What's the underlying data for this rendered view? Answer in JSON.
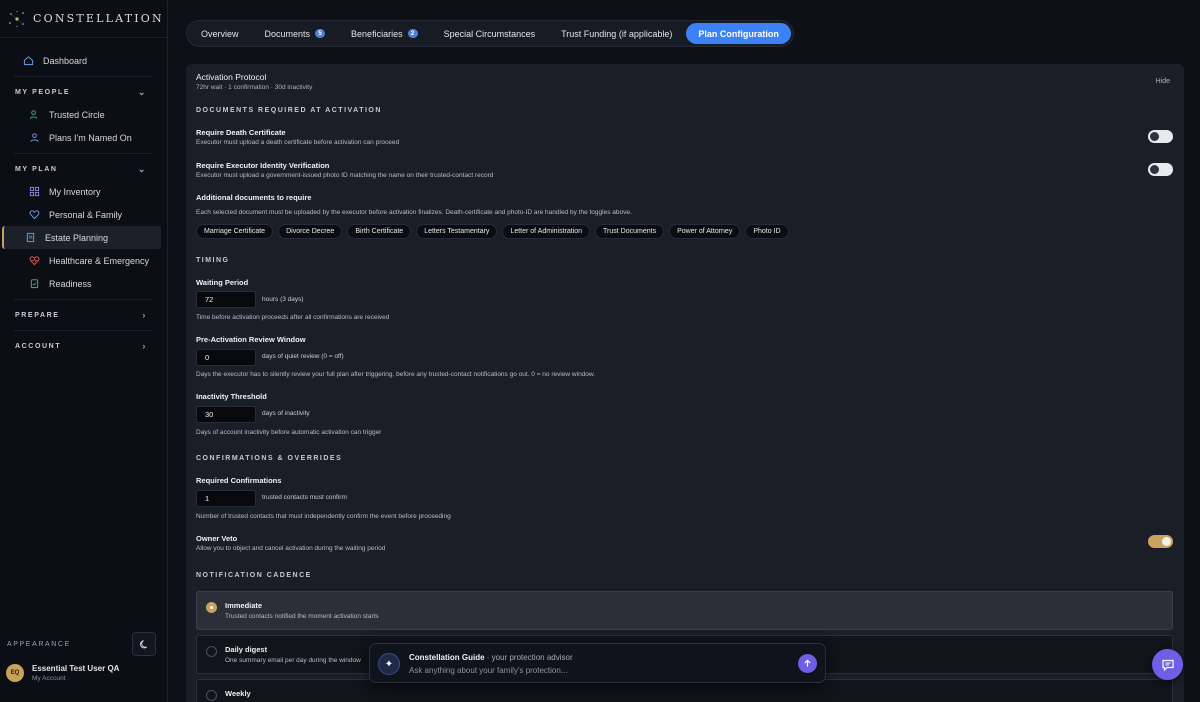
{
  "brand": {
    "name": "CONSTELLATION"
  },
  "nav": {
    "dashboard": "Dashboard",
    "my_people": {
      "label": "MY PEOPLE",
      "items": [
        "Trusted Circle",
        "Plans I'm Named On"
      ]
    },
    "my_plan": {
      "label": "MY PLAN",
      "items": [
        "My Inventory",
        "Personal & Family",
        "Estate Planning",
        "Healthcare & Emergency",
        "Readiness"
      ]
    },
    "prepare": "PREPARE",
    "account": "ACCOUNT"
  },
  "appearance": "APPEARANCE",
  "user": {
    "initials": "EQ",
    "name": "Essential Test User QA",
    "sub": "My Account"
  },
  "tabs": [
    {
      "label": "Overview"
    },
    {
      "label": "Documents",
      "badge": "5"
    },
    {
      "label": "Beneficiaries",
      "badge": "2"
    },
    {
      "label": "Special Circumstances"
    },
    {
      "label": "Trust Funding (if applicable)"
    },
    {
      "label": "Plan Configuration"
    }
  ],
  "panel": {
    "title": "Activation Protocol",
    "summary": "72hr wait · 1 confirmation · 30d inactivity",
    "hide": "Hide",
    "docs_section": "DOCUMENTS REQUIRED AT ACTIVATION",
    "death_cert": {
      "label": "Require Death Certificate",
      "desc": "Executor must upload a death certificate before activation can proceed",
      "on": false
    },
    "id_verify": {
      "label": "Require Executor Identity Verification",
      "desc": "Executor must upload a government-issued photo ID matching the name on their trusted-contact record",
      "on": false
    },
    "additional": {
      "label": "Additional documents to require",
      "desc": "Each selected document must be uploaded by the executor before activation finalizes. Death-certificate and photo-ID are handled by the toggles above."
    },
    "chips": [
      "Marriage Certificate",
      "Divorce Decree",
      "Birth Certificate",
      "Letters Testamentary",
      "Letter of Administration",
      "Trust Documents",
      "Power of Attorney",
      "Photo ID"
    ],
    "timing_section": "TIMING",
    "waiting": {
      "label": "Waiting Period",
      "value": "72",
      "unit": "hours (3 days)",
      "desc": "Time before activation proceeds after all confirmations are received"
    },
    "review": {
      "label": "Pre-Activation Review Window",
      "value": "0",
      "unit": "days of quiet review (0 = off)",
      "desc": "Days the executor has to silently review your full plan after triggering, before any trusted-contact notifications go out. 0 = no review window."
    },
    "inactivity": {
      "label": "Inactivity Threshold",
      "value": "30",
      "unit": "days of inactivity",
      "desc": "Days of account inactivity before automatic activation can trigger"
    },
    "confirm_section": "CONFIRMATIONS & OVERRIDES",
    "confirmations": {
      "label": "Required Confirmations",
      "value": "1",
      "unit": "trusted contacts must confirm",
      "desc": "Number of trusted contacts that must independently confirm the event before proceeding"
    },
    "veto": {
      "label": "Owner Veto",
      "desc": "Allow you to object and cancel activation during the waiting period",
      "on": true
    },
    "cadence_section": "NOTIFICATION CADENCE",
    "cadence": [
      {
        "title": "Immediate",
        "desc": "Trusted contacts notified the moment activation starts",
        "selected": true
      },
      {
        "title": "Daily digest",
        "desc": "One summary email per day during the window",
        "selected": false
      },
      {
        "title": "Weekly",
        "desc": "",
        "selected": false
      }
    ]
  },
  "guide": {
    "title": "Constellation Guide",
    "subtitle": "· your protection advisor",
    "placeholder": "Ask anything about your family's protection..."
  },
  "colors": {
    "accent": "#3b82f6",
    "gold": "#c9a35f",
    "purple": "#6d5fe6"
  }
}
